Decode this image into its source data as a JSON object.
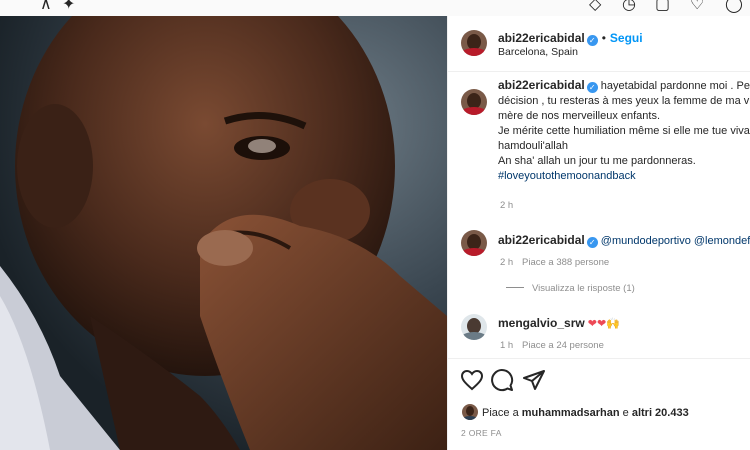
{
  "post": {
    "author": "abi22ericabidal",
    "follow_label": "Segui",
    "location": "Barcelona, Spain",
    "caption_lines": [
      "hayetabidal pardonne moi . Peu i",
      "décision , tu resteras à mes yeux la femme de ma vie",
      "mère de nos merveilleux enfants.",
      "Je mérite cette humiliation même si elle me tue vivan",
      "hamdouli'allah",
      "An sha' allah un jour tu me pardonneras."
    ],
    "caption_hashtag": "#loveyoutothemoonandback",
    "caption_time": "2 h"
  },
  "comments": [
    {
      "user": "abi22ericabidal",
      "mentions": "@mundodeportivo @lemondefr",
      "time": "2 h",
      "likes": "Piace a 388 persone",
      "replies": "Visualizza le risposte (1)"
    },
    {
      "user": "mengalvio_srw",
      "emojis": "❤❤🙌",
      "time": "1 h",
      "likes": "Piace a 24 persone"
    }
  ],
  "likes_summary": {
    "prefix": "Piace a",
    "user": "muhammadsarhan",
    "middle": "e",
    "others": "altri 20.433"
  },
  "timestamp": "2 ORE FA",
  "icons": [
    "heart-icon",
    "comment-icon",
    "share-icon",
    "verified-badge-icon",
    "small-heart-icon"
  ],
  "colors": {
    "link_blue": "#0095f6",
    "hashtag": "#00376b",
    "muted": "#8e8e8e",
    "heart_red": "#ed4956"
  }
}
